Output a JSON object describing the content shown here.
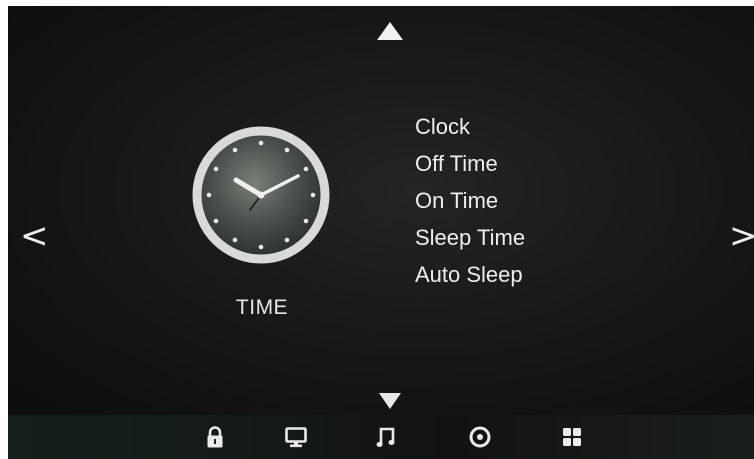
{
  "screen": {
    "section_label": "TIME",
    "section_icon": "clock-icon"
  },
  "menu": {
    "items": [
      {
        "label": "Clock"
      },
      {
        "label": "Off Time"
      },
      {
        "label": "On Time"
      },
      {
        "label": "Sleep Time"
      },
      {
        "label": "Auto Sleep"
      }
    ]
  },
  "navigation": {
    "left_arrow": "<",
    "right_arrow": ">",
    "up_icon": "triangle-up-icon",
    "down_icon": "triangle-down-icon"
  },
  "bottom_bar": {
    "icons": [
      "lock-icon",
      "monitor-icon",
      "music-note-icon",
      "disc-icon",
      "grid-icon"
    ]
  },
  "colors": {
    "background": "#161616",
    "foreground": "#eeeeee"
  }
}
